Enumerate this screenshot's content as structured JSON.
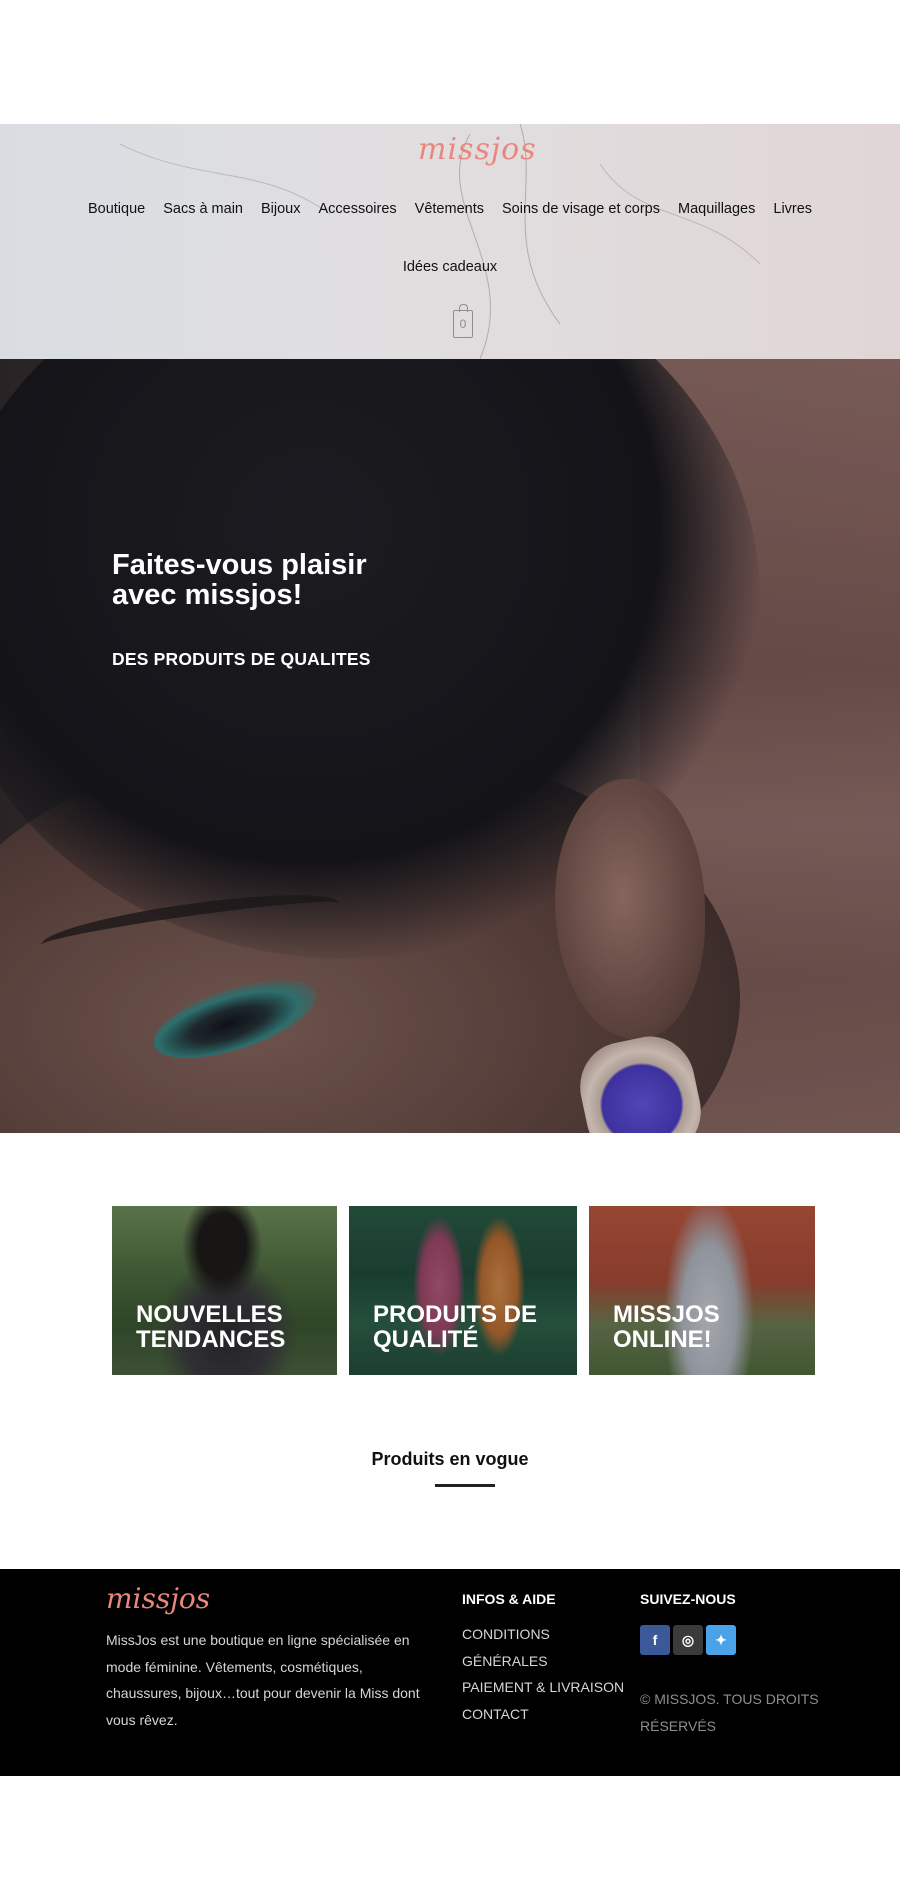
{
  "header": {
    "logo_text": "missjos",
    "nav_items": [
      {
        "label": "Boutique"
      },
      {
        "label": "Sacs à main"
      },
      {
        "label": "Bijoux"
      },
      {
        "label": "Accessoires"
      },
      {
        "label": "Vêtements"
      },
      {
        "label": "Soins de visage et corps"
      },
      {
        "label": "Maquillages"
      },
      {
        "label": "Livres"
      }
    ],
    "nav_item_row2": "Idées cadeaux",
    "cart_count": "0",
    "cart_icon": "shopping-bag-icon"
  },
  "hero": {
    "title": "Faites-vous plaisir avec missjos!",
    "subtitle": "DES PRODUITS DE QUALITES"
  },
  "tiles": [
    {
      "label": "NOUVELLES TENDANCES"
    },
    {
      "label": "PRODUITS DE QUALITÉ"
    },
    {
      "label": "MISSJOS ONLINE!"
    }
  ],
  "section": {
    "title": "Produits en vogue"
  },
  "footer": {
    "logo_text": "missjos",
    "description": "MissJos est une boutique en ligne spécialisée en mode féminine. Vêtements, cosmétiques, chaussures, bijoux…tout pour devenir la Miss dont vous rêvez.",
    "info_title": "INFOS & AIDE",
    "info_links": [
      {
        "label": "CONDITIONS GÉNÉRALES"
      },
      {
        "label": "PAIEMENT & LIVRAISON"
      },
      {
        "label": "CONTACT"
      }
    ],
    "follow_title": "SUIVEZ-NOUS",
    "social": [
      {
        "icon": "facebook-icon",
        "glyph": "f",
        "color": "#3b5998"
      },
      {
        "icon": "instagram-icon",
        "glyph": "◎",
        "color": "#3a3a3a"
      },
      {
        "icon": "twitter-icon",
        "glyph": "✦",
        "color": "#4aa3e8"
      }
    ],
    "copyright": "© MISSJOS. TOUS DROITS RÉSERVÉS"
  },
  "colors": {
    "brand_logo": "#e9877f",
    "footer_bg": "#000000"
  }
}
